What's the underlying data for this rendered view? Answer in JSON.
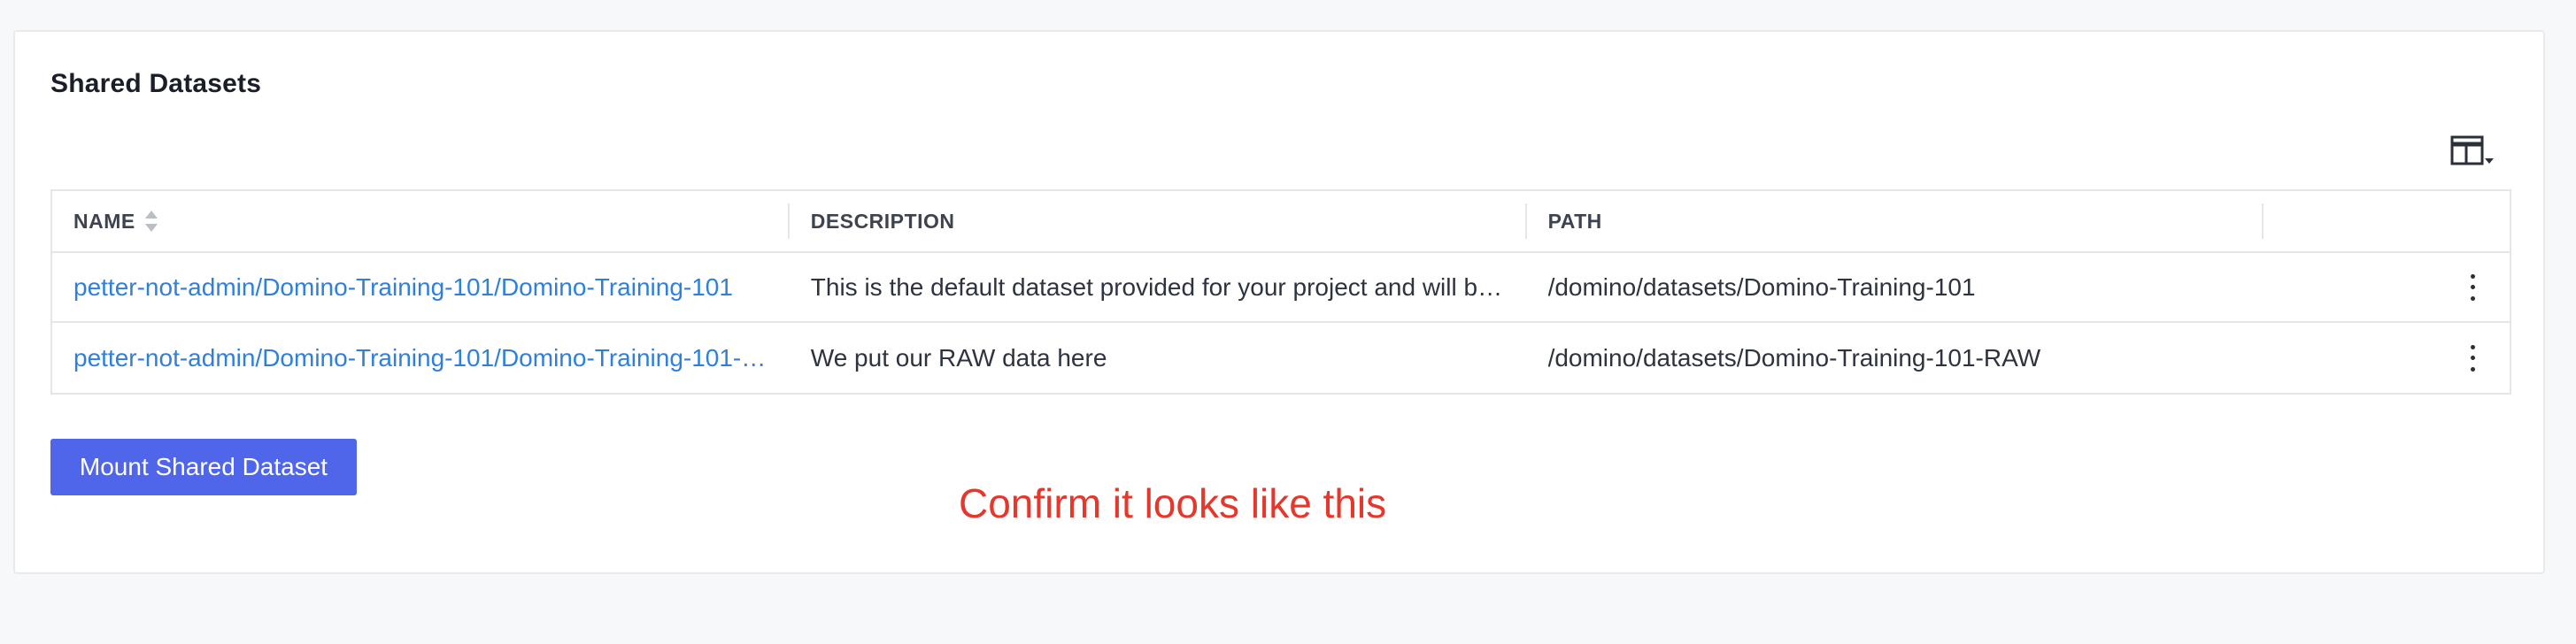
{
  "panel": {
    "title": "Shared Datasets",
    "columns_icon": "table-columns-icon"
  },
  "table": {
    "headers": {
      "name": "NAME",
      "description": "DESCRIPTION",
      "path": "PATH"
    },
    "rows": [
      {
        "name": "petter-not-admin/Domino-Training-101/Domino-Training-101",
        "description": "This is the default dataset provided for your project and will b…",
        "path": "/domino/datasets/Domino-Training-101"
      },
      {
        "name": "petter-not-admin/Domino-Training-101/Domino-Training-101-…",
        "description": "We put our RAW data here",
        "path": "/domino/datasets/Domino-Training-101-RAW"
      }
    ]
  },
  "actions": {
    "mount_label": "Mount Shared Dataset"
  },
  "annotation": {
    "text": "Confirm it looks like this",
    "color": "#e5372b"
  },
  "colors": {
    "accent": "#4f66ea",
    "link": "#2f7fdb"
  }
}
